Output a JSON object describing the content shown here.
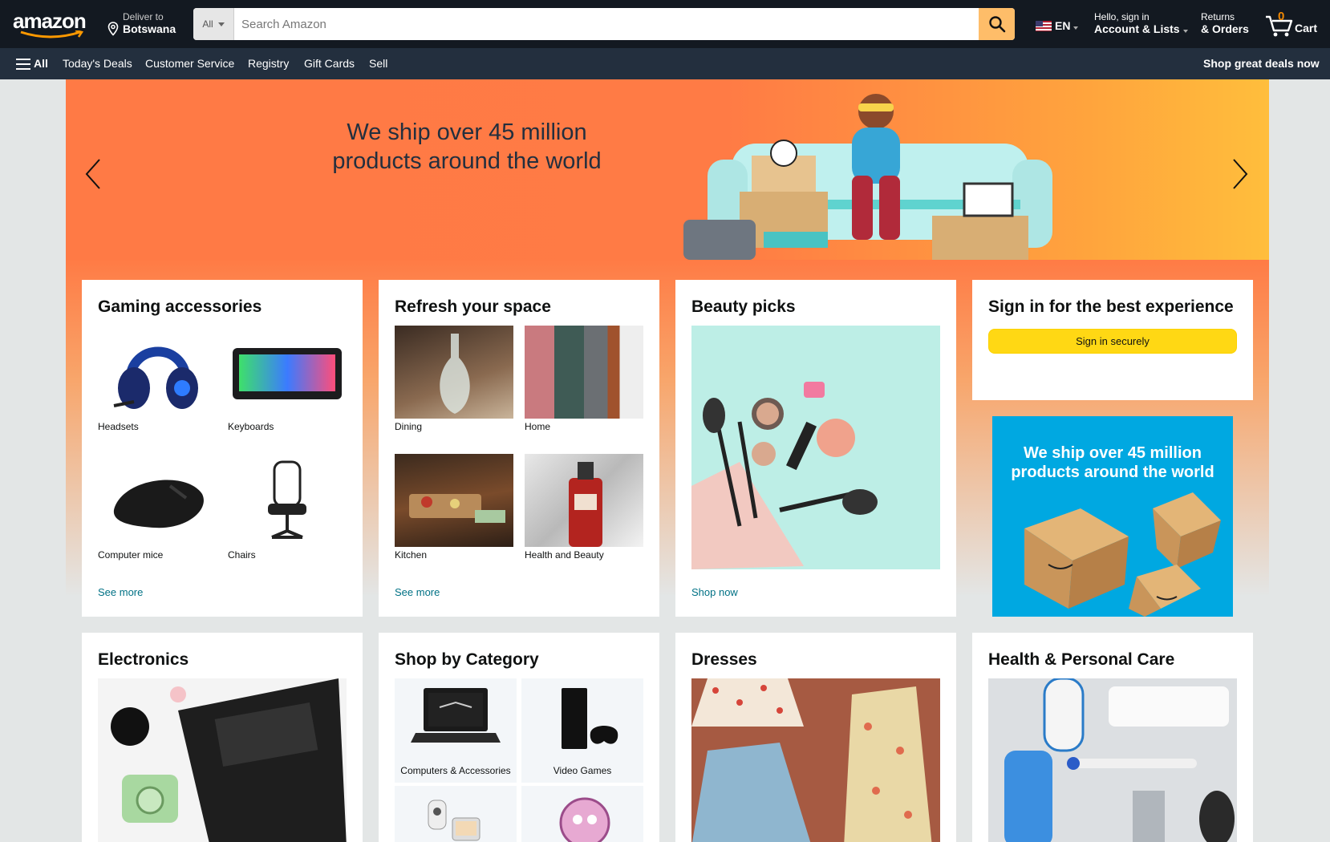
{
  "nav": {
    "logo": "amazon",
    "deliver_line1": "Deliver to",
    "deliver_line2": "Botswana",
    "search_category": "All",
    "search_placeholder": "Search Amazon",
    "language": "EN",
    "account_line1": "Hello, sign in",
    "account_line2": "Account & Lists",
    "returns_line1": "Returns",
    "returns_line2": "& Orders",
    "cart_count": "0",
    "cart_label": "Cart",
    "icons": [
      "location-pin-icon",
      "search-icon",
      "us-flag-icon",
      "cart-icon"
    ]
  },
  "subnav": {
    "all": "All",
    "items": [
      "Today's Deals",
      "Customer Service",
      "Registry",
      "Gift Cards",
      "Sell"
    ],
    "promo": "Shop great deals now"
  },
  "hero": {
    "title": "We ship over 45 million products around the world"
  },
  "cards": {
    "gaming": {
      "title": "Gaming accessories",
      "items": [
        "Headsets",
        "Keyboards",
        "Computer mice",
        "Chairs"
      ],
      "link": "See more"
    },
    "refresh": {
      "title": "Refresh your space",
      "items": [
        "Dining",
        "Home",
        "Kitchen",
        "Health and Beauty"
      ],
      "link": "See more"
    },
    "beauty": {
      "title": "Beauty picks",
      "link": "Shop now"
    },
    "signin": {
      "title": "Sign in for the best experience",
      "button": "Sign in securely"
    },
    "ad": {
      "text": "We ship over 45 million products around the world"
    },
    "electronics": {
      "title": "Electronics"
    },
    "category": {
      "title": "Shop by Category",
      "items": [
        "Computers & Accessories",
        "Video Games"
      ]
    },
    "dresses": {
      "title": "Dresses"
    },
    "health": {
      "title": "Health & Personal Care"
    }
  },
  "colors": {
    "nav_bg": "#131921",
    "subnav_bg": "#232f3e",
    "search_btn": "#febd69",
    "signin_btn": "#ffd814",
    "link": "#007185",
    "hero_orange": "#ff7a45",
    "ad_blue": "#00a8e1"
  }
}
